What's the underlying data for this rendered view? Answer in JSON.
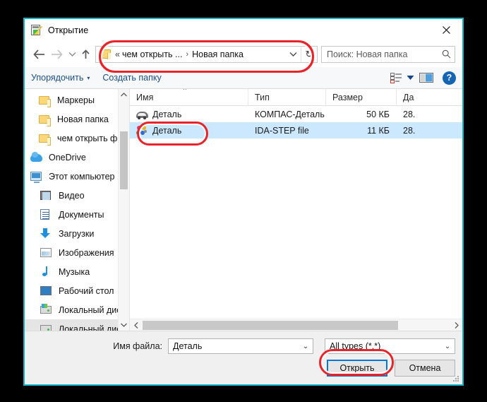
{
  "window": {
    "title": "Открытие",
    "title_icon": "notepad-edit-icon",
    "close_label": "✕"
  },
  "nav": {
    "back_icon": "arrow-left-icon",
    "forward_icon": "arrow-right-icon",
    "recent_icon": "chevron-down-icon",
    "up_icon": "arrow-up-icon"
  },
  "address": {
    "folder_icon": "folder-icon",
    "double_chevron": "«",
    "crumb1": "чем открыть ...",
    "separator": "›",
    "crumb2": "Новая папка",
    "dropdown_icon": "chevron-down-icon",
    "refresh_icon": "↻"
  },
  "search": {
    "placeholder": "Поиск: Новая папка",
    "icon": "search-icon"
  },
  "toolbar": {
    "organize_label": "Упорядочить",
    "organize_caret": "▾",
    "new_folder_label": "Создать папку",
    "view_icon": "list-view-icon",
    "view_caret": "▾",
    "preview_icon": "preview-pane-icon",
    "help_label": "?"
  },
  "sidebar": {
    "items": [
      {
        "label": "Маркеры",
        "icon": "folder-icon",
        "indent": "indent1",
        "selected": false
      },
      {
        "label": "Новая папка",
        "icon": "folder-icon",
        "indent": "indent1",
        "selected": false
      },
      {
        "label": "чем открыть фа",
        "icon": "folder-icon",
        "indent": "indent1",
        "selected": false
      },
      {
        "label": "OneDrive",
        "icon": "onedrive-cloud-icon",
        "indent": "",
        "selected": false
      },
      {
        "label": "Этот компьютер",
        "icon": "this-pc-icon",
        "indent": "",
        "selected": false
      },
      {
        "label": "Видео",
        "icon": "videos-icon",
        "indent": "indent2",
        "selected": false
      },
      {
        "label": "Документы",
        "icon": "documents-icon",
        "indent": "indent2",
        "selected": false
      },
      {
        "label": "Загрузки",
        "icon": "downloads-icon",
        "indent": "indent2",
        "selected": false
      },
      {
        "label": "Изображения",
        "icon": "pictures-icon",
        "indent": "indent2",
        "selected": false
      },
      {
        "label": "Музыка",
        "icon": "music-icon",
        "indent": "indent2",
        "selected": false
      },
      {
        "label": "Рабочий стол",
        "icon": "desktop-icon",
        "indent": "indent2",
        "selected": false
      },
      {
        "label": "Локальный дис",
        "icon": "system-drive-icon",
        "indent": "indent2",
        "selected": false
      },
      {
        "label": "Локальный дис",
        "icon": "drive-icon",
        "indent": "indent2",
        "selected": true
      }
    ],
    "scroll_up_icon": "chevron-up-icon",
    "scroll_down_icon": "chevron-down-icon"
  },
  "filelist": {
    "columns": {
      "name": "Имя",
      "type": "Тип",
      "size": "Размер",
      "date": "Да"
    },
    "sort_indicator": "^",
    "rows": [
      {
        "name": "Деталь",
        "icon": "kompas-file-icon",
        "type": "КОМПАС-Деталь",
        "size": "50 КБ",
        "date": "28.",
        "selected": false
      },
      {
        "name": "Деталь",
        "icon": "ida-step-file-icon",
        "type": "IDA-STEP file",
        "size": "11 КБ",
        "date": "28.",
        "selected": true
      }
    ],
    "hscroll_left_icon": "chevron-left-icon",
    "hscroll_right_icon": "chevron-right-icon"
  },
  "footer": {
    "filename_label": "Имя файла:",
    "filename_value": "Деталь",
    "filename_caret": "⌄",
    "filter_value": "All types (*.*)",
    "filter_caret": "⌄",
    "open_button": "Открыть",
    "cancel_button": "Отмена"
  },
  "annotations": {
    "address_highlight": "red-rounded-rect-address-bar",
    "file_highlight": "red-rounded-rect-selected-file",
    "open_highlight": "red-rounded-rect-open-button",
    "color": "#e8242a"
  }
}
